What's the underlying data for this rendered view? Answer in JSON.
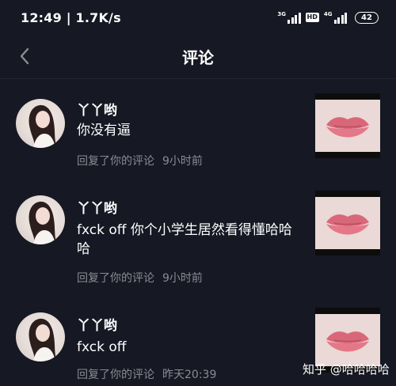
{
  "status_bar": {
    "time_speed": "12:49 | 1.7K/s",
    "net1_label": "3G",
    "hd_badge": "HD",
    "net2_label": "4G",
    "battery": "42"
  },
  "header": {
    "title": "评论",
    "back_icon": "chevron-left-icon"
  },
  "comments": [
    {
      "username": "丫丫哟",
      "text": "你没有逼",
      "action": "回复了你的评论",
      "time": "9小时前"
    },
    {
      "username": "丫丫哟",
      "text": "fxck off 你个小学生居然看得懂哈哈哈",
      "action": "回复了你的评论",
      "time": "9小时前"
    },
    {
      "username": "丫丫哟",
      "text": "fxck off",
      "action": "回复了你的评论",
      "time": "昨天20:39"
    }
  ],
  "watermark": "知乎 @哈哈哈哈",
  "colors": {
    "background": "#161823",
    "meta_text": "#8a8b93",
    "lips": "#e06b7e"
  }
}
